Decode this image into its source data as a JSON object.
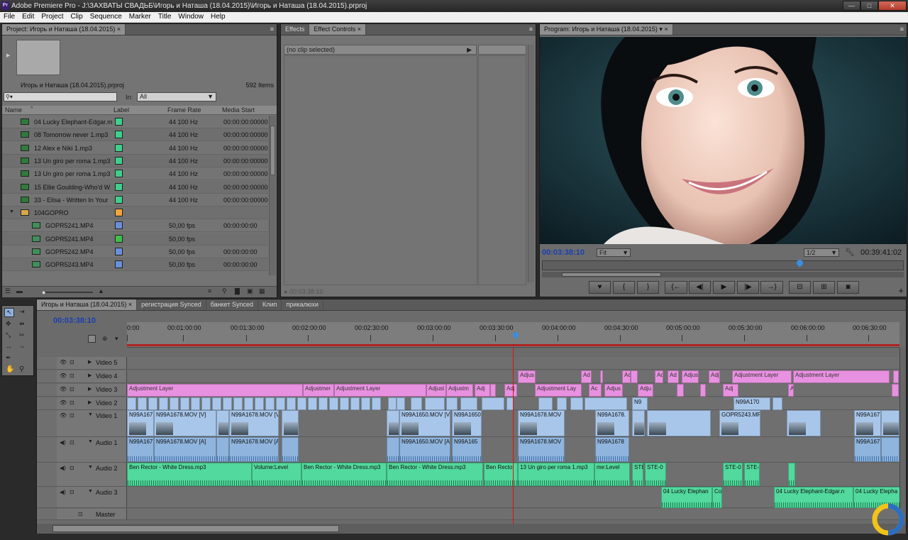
{
  "window": {
    "title": "Adobe Premiere Pro - J:\\ЗАХВАТЫ СВАДЬБ\\Игорь и Наташа (18.04.2015)\\Игорь и Наташа (18.04.2015).prproj",
    "app_badge": "Pr",
    "controls": {
      "minimize": "—",
      "maximize": "□",
      "close": "✕"
    }
  },
  "menu": [
    "File",
    "Edit",
    "Project",
    "Clip",
    "Sequence",
    "Marker",
    "Title",
    "Window",
    "Help"
  ],
  "project": {
    "tab": "Project: Игорь и Наташа (18.04.2015)",
    "filename": "Игорь и Наташа (18.04.2015).prproj",
    "items_count": "592 Items",
    "search_placeholder": "",
    "in_label": "In:",
    "in_value": "All",
    "columns": [
      "Name",
      "Label",
      "Frame Rate",
      "Media Start"
    ],
    "rows": [
      {
        "name": "04 Lucky Elephant-Edgar.m",
        "rate": "44 100 Hz",
        "start": "00:00:00:00000",
        "color": "#3fcf8c",
        "type": "audio",
        "indent": false
      },
      {
        "name": "08 Tomorrow never 1.mp3",
        "rate": "44 100 Hz",
        "start": "00:00:00:00000",
        "color": "#3fcf8c",
        "type": "audio",
        "indent": false
      },
      {
        "name": "12 Alex e Niki 1.mp3",
        "rate": "44 100 Hz",
        "start": "00:00:00:00000",
        "color": "#3fcf8c",
        "type": "audio",
        "indent": false
      },
      {
        "name": "13 Un giro per roma 1.mp3",
        "rate": "44 100 Hz",
        "start": "00:00:00:00000",
        "color": "#3fcf8c",
        "type": "audio",
        "indent": false
      },
      {
        "name": "13 Un giro per roma 1.mp3",
        "rate": "44 100 Hz",
        "start": "00:00:00:00000",
        "color": "#3fcf8c",
        "type": "audio",
        "indent": false
      },
      {
        "name": "15 Ellie Goulding-Who'd W",
        "rate": "44 100 Hz",
        "start": "00:00:00:00000",
        "color": "#3fcf8c",
        "type": "audio",
        "indent": false
      },
      {
        "name": "33 - Elisa - Written In Your",
        "rate": "44 100 Hz",
        "start": "00:00:00:00000",
        "color": "#3fcf8c",
        "type": "audio",
        "indent": false
      },
      {
        "name": "104GOPRO",
        "rate": "",
        "start": "",
        "color": "#f0a63c",
        "type": "folder",
        "indent": false
      },
      {
        "name": "GOPR5241.MP4",
        "rate": "50,00 fps",
        "start": "00:00:00:00",
        "color": "#6b8fd8",
        "type": "video",
        "indent": true
      },
      {
        "name": "GOPR5241.MP4",
        "rate": "50,00 fps",
        "start": "",
        "color": "#3fbf4c",
        "type": "seq",
        "indent": true
      },
      {
        "name": "GOPR5242.MP4",
        "rate": "50,00 fps",
        "start": "00:00:00:00",
        "color": "#6b8fd8",
        "type": "video",
        "indent": true
      },
      {
        "name": "GOPR5243.MP4",
        "rate": "50,00 fps",
        "start": "00:00:00:00",
        "color": "#6b8fd8",
        "type": "video",
        "indent": true
      }
    ]
  },
  "effects": {
    "tabs": [
      "Effects",
      "Effect Controls"
    ],
    "no_clip": "(no clip selected)",
    "timecode": "00:03:38:10"
  },
  "program": {
    "tab": "Program: Игорь и Наташа (18.04.2015)",
    "timecode": "00:03:38:10",
    "fit": "Fit",
    "resolution": "1/2",
    "duration": "00:39:41:02",
    "buttons": [
      "♥",
      "{",
      "}",
      "{←",
      "◀|",
      "▶",
      "|▶",
      "→}",
      "⊟",
      "⊞",
      "◙"
    ],
    "playhead_fraction": 0.7
  },
  "timeline": {
    "tabs": [
      "Игорь и Наташа (18.04.2015)",
      "регистрация Synced",
      "банкет Synced",
      "Клип",
      "прикалюхи"
    ],
    "timecode": "00:03:38:10",
    "ruler": [
      "0:00",
      "00:01:00:00",
      "00:01:30:00",
      "00:02:00:00",
      "00:02:30:00",
      "00:03:00:00",
      "00:03:30:00",
      "00:04:00:00",
      "00:04:30:00",
      "00:05:00:00",
      "00:05:30:00",
      "00:06:00:00",
      "00:06:30:00"
    ],
    "tracks": [
      "Video 5",
      "Video 4",
      "Video 3",
      "Video 2",
      "Video 1",
      "Audio 1",
      "Audio 2",
      "Audio 3",
      "Master"
    ],
    "clips": {
      "v4": [
        "Adjus",
        "Ad",
        "Ac",
        "Ad",
        "Ad",
        "Adjus",
        "Adj",
        "Adjustment Layer",
        "Adjustment Layer"
      ],
      "v3": [
        "Adjustment Layer",
        "Adjustmer",
        "Adjustment Layer",
        "Adjust",
        "Adjustm",
        "Adj",
        "Adj",
        "Adjustment Lay",
        "Ac",
        "Adjus",
        "Adju",
        "Adj",
        "A"
      ],
      "v2": [
        "N99A170",
        "N9"
      ],
      "v1": [
        "N99A167",
        "N99A1678.MOV [V]",
        "N99A1678.MOV [V",
        "N99A1650.MOV [V]",
        "N99A1650",
        "N99A1678.MOV",
        "N99A1678.",
        "GOPR5243.MP",
        "N99A167"
      ],
      "a1": [
        "N99A167",
        "N99A1678.MOV [A]",
        "N99A1678.MOV [A",
        "N99A1650.MOV [A]",
        "N99A165",
        "N99A1678.MOV",
        "N99A1678",
        "N99A167"
      ],
      "a2": [
        "Ben Rector - White Dress.mp3",
        "Volume:Level",
        "Ben Rector - White Dress.mp3",
        "Ben Rector - White Dress.mp3",
        "Ben Recto",
        "13 Un giro per roma 1.mp3",
        "me:Level",
        "STE",
        "STE-0",
        "STE-0",
        "STE-("
      ],
      "a3": [
        "04 Lucky Elephan",
        "Co",
        "04 Lucky Elephant-Edgar.n",
        "04 Lucky Elepha"
      ]
    }
  }
}
